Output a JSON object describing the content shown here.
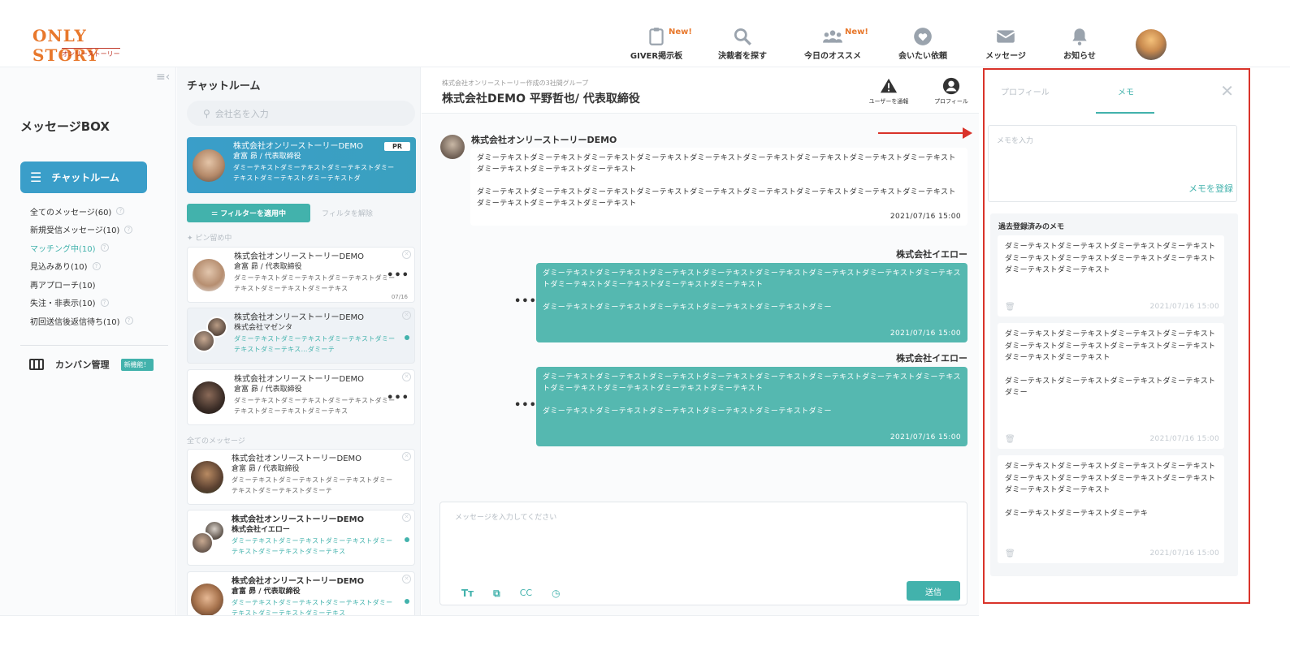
{
  "logo": {
    "main": "ONLY STORY",
    "sub": "オンリーストーリー"
  },
  "nav": [
    {
      "label": "GIVER掲示板",
      "icon": "clipboard-icon",
      "badge": "New!"
    },
    {
      "label": "決裁者を探す",
      "icon": "search-icon",
      "badge": ""
    },
    {
      "label": "今日のオススメ",
      "icon": "people-icon",
      "badge": "New!"
    },
    {
      "label": "会いたい依頼",
      "icon": "heart-icon",
      "badge": ""
    },
    {
      "label": "メッセージ",
      "icon": "envelope-icon",
      "badge": ""
    },
    {
      "label": "お知らせ",
      "icon": "bell-icon",
      "badge": ""
    }
  ],
  "sidebar": {
    "title": "メッセージBOX",
    "chatroom_label": "チャットルーム",
    "filters": [
      {
        "label": "全てのメッセージ(60)"
      },
      {
        "label": "新規受信メッセージ(10)"
      },
      {
        "label": "マッチング中(10)"
      },
      {
        "label": "見込みあり(10)"
      },
      {
        "label": "再アプローチ(10)"
      },
      {
        "label": "失注・非表示(10)"
      },
      {
        "label": "初回送信後返信待ち(10)"
      }
    ],
    "kanban_label": "カンバン管理",
    "kanban_badge": "新機能！"
  },
  "chatlist": {
    "title": "チャットルーム",
    "search_placeholder": "会社名を入力",
    "pr_card": {
      "company": "株式会社オンリーストーリーDEMO",
      "person": "倉富 昴 / 代表取締役",
      "preview": "ダミーテキストダミーテキストダミーテキストダミーテキストダミーテキストダミーテキストダ",
      "badge": "PR"
    },
    "filter_button": "フィルターを適用中",
    "filter_clear": "フィルタを解除",
    "pinned_label": "ピン留め中",
    "all_label": "全てのメッセージ",
    "cards": [
      {
        "company": "株式会社オンリーストーリーDEMO",
        "person": "倉富 昴 / 代表取締役",
        "preview": "ダミーテキストダミーテキストダミーテキストダミーテキストダミーテキストダミーテキス",
        "date": "07/16"
      },
      {
        "company": "株式会社オンリーストーリーDEMO",
        "person": "株式会社マゼンタ",
        "preview": "ダミーテキストダミーテキストダミーテキストダミーテキストダミーテキス…ダミーテ"
      },
      {
        "company": "株式会社オンリーストーリーDEMO",
        "person": "倉富 昴 / 代表取締役",
        "preview": "ダミーテキストダミーテキストダミーテキストダミーテキストダミーテキストダミーテキス"
      },
      {
        "company": "株式会社オンリーストーリーDEMO",
        "person": "倉富 昴 / 代表取締役",
        "preview": "ダミーテキストダミーテキストダミーテキストダミーテキストダミーテキストダミーテ"
      },
      {
        "company": "株式会社オンリーストーリーDEMO",
        "person": "株式会社イエロー",
        "preview": "ダミーテキストダミーテキストダミーテキストダミーテキストダミーテキストダミーテキス"
      },
      {
        "company": "株式会社オンリーストーリーDEMO",
        "person": "倉富 昴 / 代表取締役",
        "preview": "ダミーテキストダミーテキストダミーテキストダミーテキストダミーテキストダミーテキス"
      }
    ]
  },
  "conversation": {
    "subtitle": "株式会社オンリーストーリー作成の3社間グループ",
    "title": "株式会社DEMO 平野哲也/ 代表取締役",
    "report_label": "ユーザーを通報",
    "profile_label": "プロフィール",
    "messages": [
      {
        "sender": "株式会社オンリーストーリーDEMO",
        "para1": "ダミーテキストダミーテキストダミーテキストダミーテキストダミーテキストダミーテキストダミーテキストダミーテキストダミーテキストダミーテキストダミーテキストダミーテキスト",
        "para2": "ダミーテキストダミーテキストダミーテキストダミーテキストダミーテキストダミーテキストダミーテキストダミーテキストダミーテキストダミーテキストダミーテキストダミーテキスト",
        "time": "2021/07/16 15:00"
      },
      {
        "sender": "株式会社イエロー",
        "para1": "ダミーテキストダミーテキストダミーテキストダミーテキストダミーテキストダミーテキストダミーテキストダミーテキストダミーテキストダミーテキストダミーテキストダミーテキスト",
        "para2": "ダミーテキストダミーテキストダミーテキストダミーテキストダミーテキストダミー",
        "time": "2021/07/16 15:00"
      },
      {
        "sender": "株式会社イエロー",
        "para1": "ダミーテキストダミーテキストダミーテキストダミーテキストダミーテキストダミーテキストダミーテキストダミーテキストダミーテキストダミーテキストダミーテキストダミーテキスト",
        "para2": "ダミーテキストダミーテキストダミーテキストダミーテキストダミーテキストダミー",
        "time": "2021/07/16 15:00"
      }
    ],
    "compose_placeholder": "メッセージを入力してください",
    "tool_cc": "CC",
    "send_label": "送信"
  },
  "memo_panel": {
    "tab_profile": "プロフィール",
    "tab_memo": "メモ",
    "input_placeholder": "メモを入力",
    "register_label": "メモを登録",
    "past_title": "過去登録済みのメモ",
    "items": [
      {
        "para1": "ダミーテキストダミーテキストダミーテキストダミーテキストダミーテキストダミーテキストダミーテキストダミーテキストダミーテキストダミーテキスト",
        "para2": "",
        "time": "2021/07/16 15:00"
      },
      {
        "para1": "ダミーテキストダミーテキストダミーテキストダミーテキストダミーテキストダミーテキストダミーテキストダミーテキストダミーテキストダミーテキスト",
        "para2": "ダミーテキストダミーテキストダミーテキストダミーテキストダミー",
        "time": "2021/07/16 15:00"
      },
      {
        "para1": "ダミーテキストダミーテキストダミーテキストダミーテキストダミーテキストダミーテキストダミーテキストダミーテキストダミーテキストダミーテキスト",
        "para2": "ダミーテキストダミーテキストダミーテキ",
        "time": "2021/07/16 15:00"
      }
    ]
  },
  "colors": {
    "teal": "#42b2ac",
    "blue": "#3a9ec9",
    "accent_orange": "#e8782c",
    "highlight_red": "#d9332a"
  }
}
